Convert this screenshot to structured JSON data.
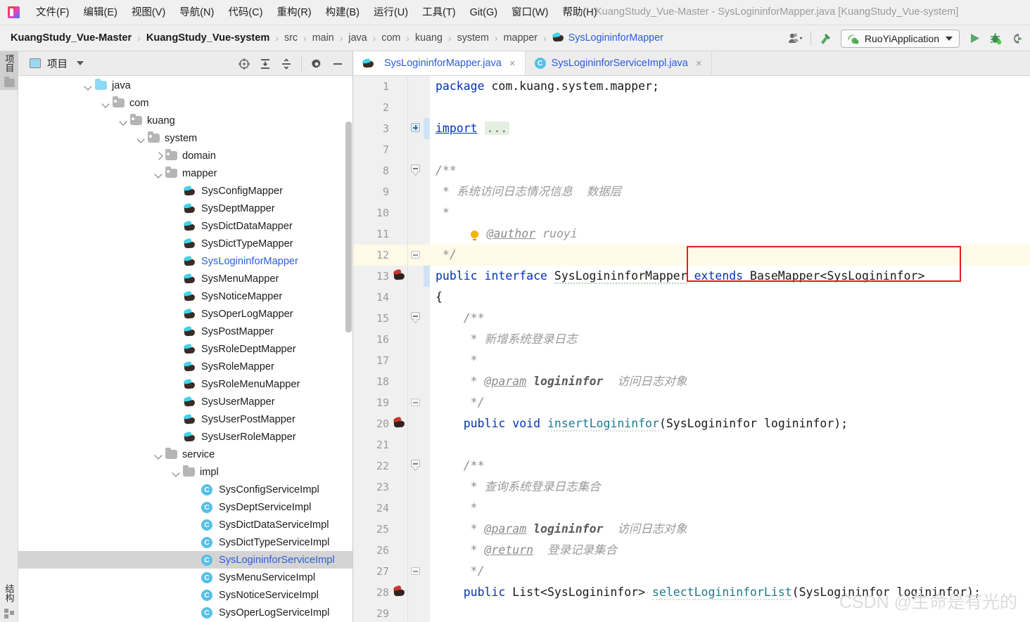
{
  "window": {
    "title": "KuangStudy_Vue-Master - SysLogininforMapper.java [KuangStudy_Vue-system]",
    "logo_icon": "intellij-idea-logo"
  },
  "menubar": {
    "items": [
      {
        "label": "文件(F)",
        "name": "menu-file"
      },
      {
        "label": "编辑(E)",
        "name": "menu-edit"
      },
      {
        "label": "视图(V)",
        "name": "menu-view"
      },
      {
        "label": "导航(N)",
        "name": "menu-navigate"
      },
      {
        "label": "代码(C)",
        "name": "menu-code"
      },
      {
        "label": "重构(R)",
        "name": "menu-refactor"
      },
      {
        "label": "构建(B)",
        "name": "menu-build"
      },
      {
        "label": "运行(U)",
        "name": "menu-run"
      },
      {
        "label": "工具(T)",
        "name": "menu-tools"
      },
      {
        "label": "Git(G)",
        "name": "menu-git"
      },
      {
        "label": "窗口(W)",
        "name": "menu-window"
      },
      {
        "label": "帮助(H)",
        "name": "menu-help"
      }
    ]
  },
  "breadcrumb": {
    "separator": "›",
    "items": [
      {
        "label": "KuangStudy_Vue-Master",
        "style": "bold"
      },
      {
        "label": "KuangStudy_Vue-system",
        "style": "bold"
      },
      {
        "label": "src",
        "style": "normal"
      },
      {
        "label": "main",
        "style": "normal"
      },
      {
        "label": "java",
        "style": "normal"
      },
      {
        "label": "com",
        "style": "normal"
      },
      {
        "label": "kuang",
        "style": "normal"
      },
      {
        "label": "system",
        "style": "normal"
      },
      {
        "label": "mapper",
        "style": "normal"
      },
      {
        "label": "SysLogininforMapper",
        "style": "link",
        "icon": "mybatis-icon"
      }
    ]
  },
  "toolbar": {
    "account_icon": "person-dropdown-icon",
    "build_icon": "hammer-icon",
    "run_config": {
      "label": "RuoYiApplication",
      "icon": "spring-boot-run-icon",
      "dropdown_icon": "chevron-down-icon"
    },
    "run_icon": "run-play-icon",
    "debug_icon": "debug-bug-icon",
    "run_coverage_icon": "run-with-coverage-icon"
  },
  "left_stripe": {
    "project_tab": "项目",
    "structure_tab": "结构"
  },
  "project_panel": {
    "title": "项目",
    "title_icon": "project-view-icon",
    "dropdown_icon": "chevron-down-icon",
    "actions": [
      {
        "name": "locate-in-tree-icon",
        "label": "target-icon"
      },
      {
        "name": "expand-all-icon",
        "label": "expand-all"
      },
      {
        "name": "collapse-all-icon",
        "label": "collapse-all"
      },
      {
        "name": "settings-gear-icon",
        "label": "gear"
      },
      {
        "name": "hide-panel-icon",
        "label": "minus"
      }
    ],
    "tree": [
      {
        "label": "java",
        "indent": 0,
        "twisty": "down",
        "icon": "folder-blue"
      },
      {
        "label": "com",
        "indent": 1,
        "twisty": "down",
        "icon": "folder-pkg"
      },
      {
        "label": "kuang",
        "indent": 2,
        "twisty": "down",
        "icon": "folder-pkg"
      },
      {
        "label": "system",
        "indent": 3,
        "twisty": "down",
        "icon": "folder-pkg"
      },
      {
        "label": "domain",
        "indent": 4,
        "twisty": "right",
        "icon": "folder-pkg"
      },
      {
        "label": "mapper",
        "indent": 4,
        "twisty": "down",
        "icon": "folder-pkg"
      },
      {
        "label": "SysConfigMapper",
        "indent": 5,
        "twisty": "none",
        "icon": "mybatis"
      },
      {
        "label": "SysDeptMapper",
        "indent": 5,
        "twisty": "none",
        "icon": "mybatis"
      },
      {
        "label": "SysDictDataMapper",
        "indent": 5,
        "twisty": "none",
        "icon": "mybatis"
      },
      {
        "label": "SysDictTypeMapper",
        "indent": 5,
        "twisty": "none",
        "icon": "mybatis"
      },
      {
        "label": "SysLogininforMapper",
        "indent": 5,
        "twisty": "none",
        "icon": "mybatis",
        "link": true
      },
      {
        "label": "SysMenuMapper",
        "indent": 5,
        "twisty": "none",
        "icon": "mybatis"
      },
      {
        "label": "SysNoticeMapper",
        "indent": 5,
        "twisty": "none",
        "icon": "mybatis"
      },
      {
        "label": "SysOperLogMapper",
        "indent": 5,
        "twisty": "none",
        "icon": "mybatis"
      },
      {
        "label": "SysPostMapper",
        "indent": 5,
        "twisty": "none",
        "icon": "mybatis"
      },
      {
        "label": "SysRoleDeptMapper",
        "indent": 5,
        "twisty": "none",
        "icon": "mybatis"
      },
      {
        "label": "SysRoleMapper",
        "indent": 5,
        "twisty": "none",
        "icon": "mybatis"
      },
      {
        "label": "SysRoleMenuMapper",
        "indent": 5,
        "twisty": "none",
        "icon": "mybatis"
      },
      {
        "label": "SysUserMapper",
        "indent": 5,
        "twisty": "none",
        "icon": "mybatis"
      },
      {
        "label": "SysUserPostMapper",
        "indent": 5,
        "twisty": "none",
        "icon": "mybatis"
      },
      {
        "label": "SysUserRoleMapper",
        "indent": 5,
        "twisty": "none",
        "icon": "mybatis"
      },
      {
        "label": "service",
        "indent": 4,
        "twisty": "down",
        "icon": "folder-plain"
      },
      {
        "label": "impl",
        "indent": 5,
        "twisty": "down",
        "icon": "folder-plain"
      },
      {
        "label": "SysConfigServiceImpl",
        "indent": 6,
        "twisty": "none",
        "icon": "classc"
      },
      {
        "label": "SysDeptServiceImpl",
        "indent": 6,
        "twisty": "none",
        "icon": "classc"
      },
      {
        "label": "SysDictDataServiceImpl",
        "indent": 6,
        "twisty": "none",
        "icon": "classc"
      },
      {
        "label": "SysDictTypeServiceImpl",
        "indent": 6,
        "twisty": "none",
        "icon": "classc"
      },
      {
        "label": "SysLogininforServiceImpl",
        "indent": 6,
        "twisty": "none",
        "icon": "classc",
        "selected": true,
        "link": true
      },
      {
        "label": "SysMenuServiceImpl",
        "indent": 6,
        "twisty": "none",
        "icon": "classc"
      },
      {
        "label": "SysNoticeServiceImpl",
        "indent": 6,
        "twisty": "none",
        "icon": "classc"
      },
      {
        "label": "SysOperLogServiceImpl",
        "indent": 6,
        "twisty": "none",
        "icon": "classc"
      }
    ]
  },
  "editor": {
    "tabs": [
      {
        "label": "SysLogininforMapper.java",
        "icon": "mybatis-icon",
        "active": true,
        "close_icon": "close-icon"
      },
      {
        "label": "SysLogininforServiceImpl.java",
        "icon": "java-class-icon",
        "active": false,
        "close_icon": "close-icon"
      }
    ],
    "lines": [
      {
        "num": "1",
        "gutter": "",
        "fold": "",
        "hl": false,
        "parts": [
          {
            "t": "package",
            "c": "kw"
          },
          {
            "t": " com.kuang.system.mapper;",
            "c": "plain"
          }
        ]
      },
      {
        "num": "2",
        "gutter": "",
        "fold": "",
        "hl": false,
        "parts": []
      },
      {
        "num": "3",
        "gutter": "",
        "fold": "plus",
        "hl": false,
        "sel": true,
        "parts": [
          {
            "t": "import",
            "c": "kw-u"
          },
          {
            "t": " ",
            "c": "plain"
          },
          {
            "t": "...",
            "c": "fold"
          }
        ]
      },
      {
        "num": "7",
        "gutter": "",
        "fold": "",
        "hl": false,
        "parts": []
      },
      {
        "num": "8",
        "gutter": "",
        "fold": "top",
        "hl": false,
        "parts": [
          {
            "t": "/**",
            "c": "cmt"
          }
        ]
      },
      {
        "num": "9",
        "gutter": "",
        "fold": "",
        "hl": false,
        "parts": [
          {
            "t": " * ",
            "c": "cmt"
          },
          {
            "t": "系统访问日志情况信息  数据层",
            "c": "doc"
          }
        ]
      },
      {
        "num": "10",
        "gutter": "",
        "fold": "",
        "hl": false,
        "parts": [
          {
            "t": " *",
            "c": "cmt"
          }
        ]
      },
      {
        "num": "11",
        "gutter": "",
        "fold": "",
        "hl": false,
        "bulb": true,
        "parts": [
          {
            "t": "@author",
            "c": "tag"
          },
          {
            "t": " ruoyi",
            "c": "doc"
          }
        ]
      },
      {
        "num": "12",
        "gutter": "",
        "fold": "bot",
        "hl": true,
        "parts": [
          {
            "t": " */",
            "c": "cmt"
          }
        ]
      },
      {
        "num": "13",
        "gutter": "mybatis",
        "fold": "",
        "hl": false,
        "sel": true,
        "parts": [
          {
            "t": "public",
            "c": "kw"
          },
          {
            "t": " ",
            "c": "plain"
          },
          {
            "t": "interface",
            "c": "kw"
          },
          {
            "t": " ",
            "c": "plain"
          },
          {
            "t": "SysLogininforMapper",
            "c": "sq"
          },
          {
            "t": " ",
            "c": "plain"
          },
          {
            "t": "extends",
            "c": "kw"
          },
          {
            "t": " BaseMapper<SysLogininfor>",
            "c": "plain"
          }
        ]
      },
      {
        "num": "14",
        "gutter": "",
        "fold": "",
        "hl": false,
        "parts": [
          {
            "t": "{",
            "c": "plain"
          }
        ]
      },
      {
        "num": "15",
        "gutter": "",
        "fold": "top",
        "hl": false,
        "parts": [
          {
            "t": "    /**",
            "c": "cmt"
          }
        ]
      },
      {
        "num": "16",
        "gutter": "",
        "fold": "",
        "hl": false,
        "parts": [
          {
            "t": "     * ",
            "c": "cmt"
          },
          {
            "t": "新增系统登录日志",
            "c": "doc"
          }
        ]
      },
      {
        "num": "17",
        "gutter": "",
        "fold": "",
        "hl": false,
        "parts": [
          {
            "t": "     *",
            "c": "cmt"
          }
        ]
      },
      {
        "num": "18",
        "gutter": "",
        "fold": "",
        "hl": false,
        "parts": [
          {
            "t": "     * ",
            "c": "cmt"
          },
          {
            "t": "@param",
            "c": "tag"
          },
          {
            "t": " ",
            "c": "plain"
          },
          {
            "t": "logininfor",
            "c": "pname"
          },
          {
            "t": "  ",
            "c": "plain"
          },
          {
            "t": "访问日志对象",
            "c": "doc"
          }
        ]
      },
      {
        "num": "19",
        "gutter": "",
        "fold": "bot",
        "hl": false,
        "parts": [
          {
            "t": "     */",
            "c": "cmt"
          }
        ]
      },
      {
        "num": "20",
        "gutter": "mybatis",
        "fold": "",
        "hl": false,
        "parts": [
          {
            "t": "    ",
            "c": "plain"
          },
          {
            "t": "public",
            "c": "kw"
          },
          {
            "t": " ",
            "c": "plain"
          },
          {
            "t": "void",
            "c": "kw"
          },
          {
            "t": " ",
            "c": "plain"
          },
          {
            "t": "insertLogininfor",
            "c": "mth-u"
          },
          {
            "t": "(SysLogininfor logininfor);",
            "c": "plain"
          }
        ]
      },
      {
        "num": "21",
        "gutter": "",
        "fold": "",
        "hl": false,
        "parts": []
      },
      {
        "num": "22",
        "gutter": "",
        "fold": "top",
        "hl": false,
        "parts": [
          {
            "t": "    /**",
            "c": "cmt"
          }
        ]
      },
      {
        "num": "23",
        "gutter": "",
        "fold": "",
        "hl": false,
        "parts": [
          {
            "t": "     * ",
            "c": "cmt"
          },
          {
            "t": "查询系统登录日志集合",
            "c": "doc"
          }
        ]
      },
      {
        "num": "24",
        "gutter": "",
        "fold": "",
        "hl": false,
        "parts": [
          {
            "t": "     *",
            "c": "cmt"
          }
        ]
      },
      {
        "num": "25",
        "gutter": "",
        "fold": "",
        "hl": false,
        "parts": [
          {
            "t": "     * ",
            "c": "cmt"
          },
          {
            "t": "@param",
            "c": "tag"
          },
          {
            "t": " ",
            "c": "plain"
          },
          {
            "t": "logininfor",
            "c": "pname"
          },
          {
            "t": "  ",
            "c": "plain"
          },
          {
            "t": "访问日志对象",
            "c": "doc"
          }
        ]
      },
      {
        "num": "26",
        "gutter": "",
        "fold": "",
        "hl": false,
        "parts": [
          {
            "t": "     * ",
            "c": "cmt"
          },
          {
            "t": "@return",
            "c": "tag"
          },
          {
            "t": "  ",
            "c": "plain"
          },
          {
            "t": "登录记录集合",
            "c": "doc"
          }
        ]
      },
      {
        "num": "27",
        "gutter": "",
        "fold": "bot",
        "hl": false,
        "parts": [
          {
            "t": "     */",
            "c": "cmt"
          }
        ]
      },
      {
        "num": "28",
        "gutter": "mybatis",
        "fold": "",
        "hl": false,
        "parts": [
          {
            "t": "    ",
            "c": "plain"
          },
          {
            "t": "public",
            "c": "kw"
          },
          {
            "t": " ",
            "c": "plain"
          },
          {
            "t": "List<SysLogininfor>",
            "c": "plain"
          },
          {
            "t": " ",
            "c": "plain"
          },
          {
            "t": "selectLogininforList",
            "c": "mth-u"
          },
          {
            "t": "(SysLogininfor logininfor);",
            "c": "plain"
          }
        ]
      },
      {
        "num": "29",
        "gutter": "",
        "fold": "",
        "hl": false,
        "parts": []
      }
    ],
    "annotation": {
      "name": "red-highlight-box",
      "target_text": "extends BaseMapper<SysLogininfor>",
      "color": "#e31e1e"
    },
    "watermark": "CSDN @生命是有光的"
  }
}
